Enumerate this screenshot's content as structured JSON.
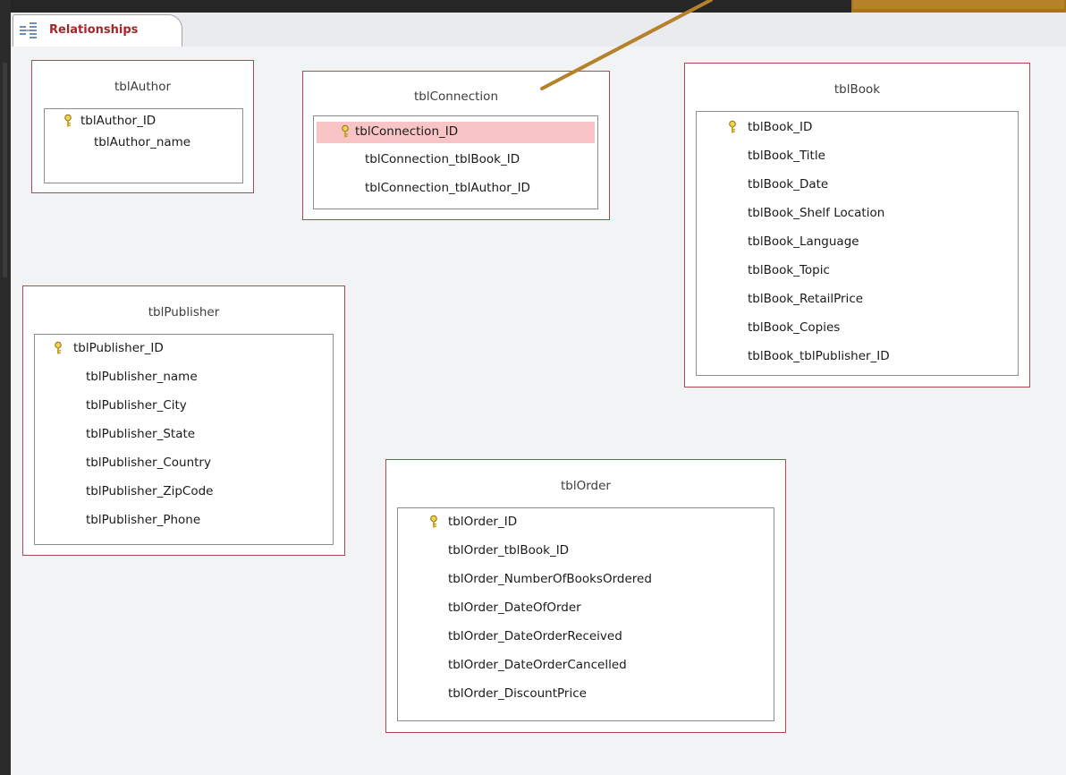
{
  "tab": {
    "label": "Relationships",
    "icon": "relationships-icon"
  },
  "tables": {
    "author": {
      "title": "tblAuthor",
      "fields": [
        "tblAuthor_ID",
        "tblAuthor_name"
      ]
    },
    "connection": {
      "title": "tblConnection",
      "fields": [
        "tblConnection_ID",
        "tblConnection_tblBook_ID",
        "tblConnection_tblAuthor_ID"
      ]
    },
    "book": {
      "title": "tblBook",
      "fields": [
        "tblBook_ID",
        "tblBook_Title",
        "tblBook_Date",
        "tblBook_Shelf Location",
        "tblBook_Language",
        "tblBook_Topic",
        "tblBook_RetailPrice",
        "tblBook_Copies",
        "tblBook_tblPublisher_ID"
      ]
    },
    "publisher": {
      "title": "tblPublisher",
      "fields": [
        "tblPublisher_ID",
        "tblPublisher_name",
        "tblPublisher_City",
        "tblPublisher_State",
        "tblPublisher_Country",
        "tblPublisher_ZipCode",
        "tblPublisher_Phone"
      ]
    },
    "order": {
      "title": "tblOrder",
      "fields": [
        "tblOrder_ID",
        "tblOrder_tblBook_ID",
        "tblOrder_NumberOfBooksOrdered",
        "tblOrder_DateOfOrder",
        "tblOrder_DateOrderReceived",
        "tblOrder_DateOrderCancelled",
        "tblOrder_DiscountPrice"
      ]
    }
  },
  "colors": {
    "tab_label": "#a4262c",
    "table_border": "#b2454f",
    "selected_row": "#f9c4c6",
    "callout": "#b5812a",
    "canvas": "#f2f3f4"
  }
}
